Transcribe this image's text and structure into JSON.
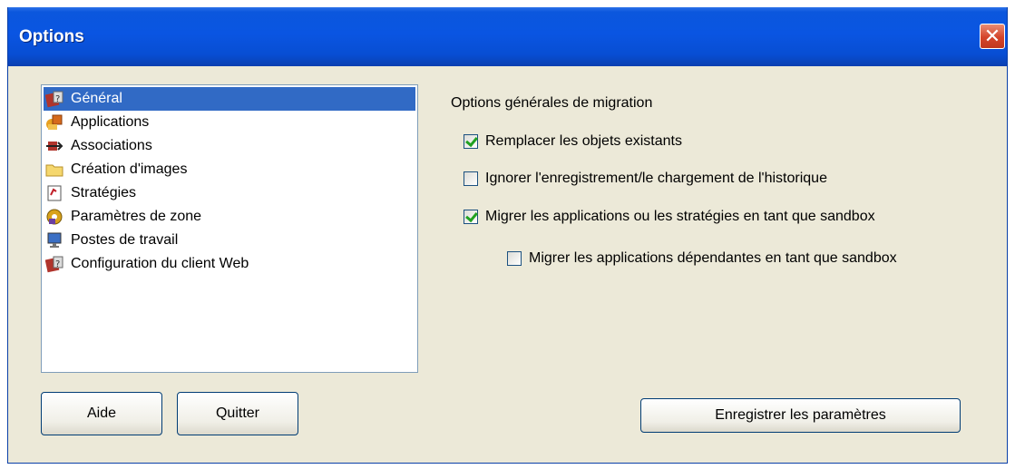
{
  "window": {
    "title": "Options",
    "close_glyph": "✕"
  },
  "sidebar": {
    "items": [
      {
        "label": "Général",
        "icon": "general-icon",
        "selected": true
      },
      {
        "label": "Applications",
        "icon": "applications-icon"
      },
      {
        "label": "Associations",
        "icon": "associations-icon"
      },
      {
        "label": "Création d'images",
        "icon": "folder-icon"
      },
      {
        "label": "Stratégies",
        "icon": "strategies-icon"
      },
      {
        "label": "Paramètres de zone",
        "icon": "zone-settings-icon"
      },
      {
        "label": "Postes de travail",
        "icon": "computer-icon"
      },
      {
        "label": "Configuration du client Web",
        "icon": "web-client-icon"
      }
    ]
  },
  "general": {
    "heading": "Options générales de migration",
    "options": [
      {
        "label": "Remplacer les objets existants",
        "checked": true
      },
      {
        "label": "Ignorer l'enregistrement/le chargement de l'historique",
        "checked": false
      },
      {
        "label": "Migrer les applications ou les stratégies en tant que sandbox",
        "checked": true
      },
      {
        "label": "Migrer les applications dépendantes en tant que sandbox",
        "checked": false
      }
    ]
  },
  "buttons": {
    "help": "Aide",
    "quit": "Quitter",
    "save": "Enregistrer les paramètres"
  },
  "colors": {
    "selection": "#316ac5",
    "titlebar": "#0a55e2",
    "dialog_bg": "#ece9d8"
  }
}
